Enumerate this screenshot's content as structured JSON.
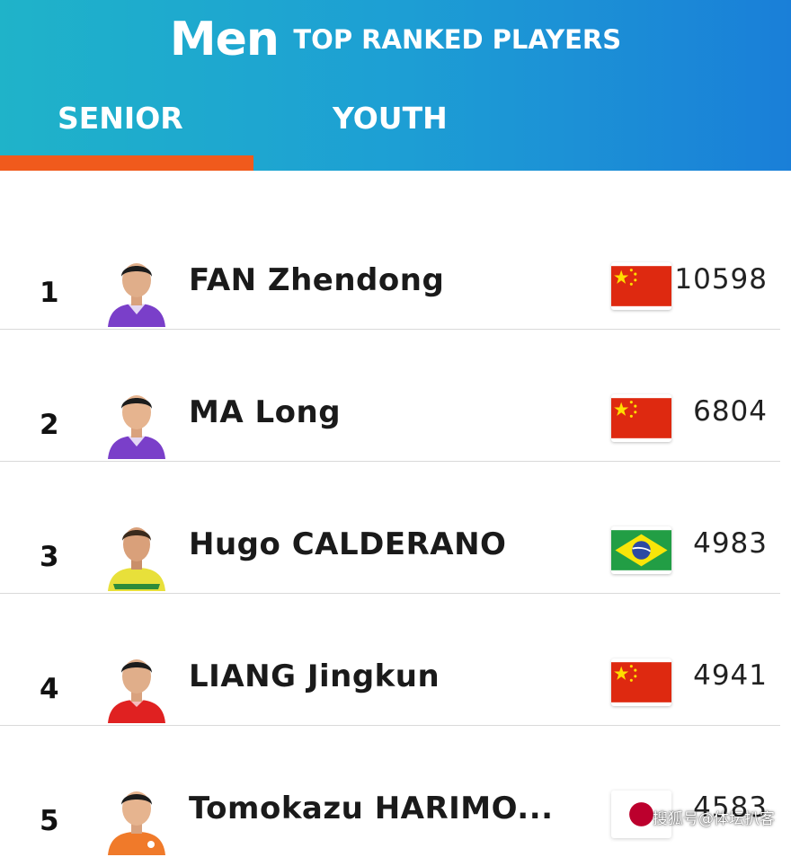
{
  "header": {
    "title": "Men",
    "subtitle": "TOP RANKED PLAYERS",
    "accent_color": "#f05a1c"
  },
  "tabs": [
    {
      "label": "SENIOR",
      "active": true
    },
    {
      "label": "YOUTH",
      "active": false
    }
  ],
  "players": [
    {
      "rank": "1",
      "name": "FAN Zhendong",
      "points": "10598",
      "flag": "china-flag-icon",
      "jersey_color": "#7a3fc9"
    },
    {
      "rank": "2",
      "name": "MA Long",
      "points": "6804",
      "flag": "china-flag-icon",
      "jersey_color": "#7a3fc9"
    },
    {
      "rank": "3",
      "name": "Hugo CALDERANO",
      "points": "4983",
      "flag": "brazil-flag-icon",
      "jersey_color": "#e8e03a"
    },
    {
      "rank": "4",
      "name": "LIANG Jingkun",
      "points": "4941",
      "flag": "china-flag-icon",
      "jersey_color": "#e02121"
    },
    {
      "rank": "5",
      "name": "Tomokazu HARIMO...",
      "points": "4583",
      "flag": "japan-flag-icon",
      "jersey_color": "#f07a2a"
    }
  ],
  "watermark": "搜狐号@体坛扒客"
}
